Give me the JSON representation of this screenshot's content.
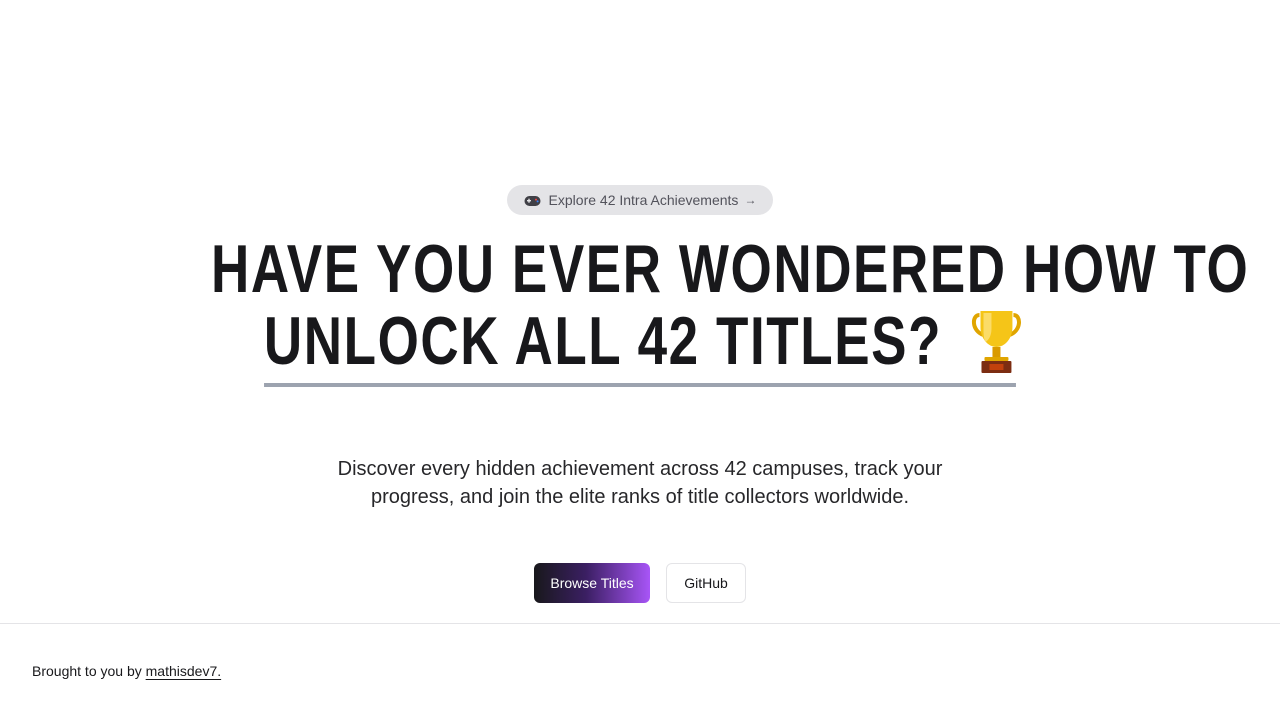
{
  "hero": {
    "pill_label": "Explore 42 Intra Achievements",
    "pill_arrow": "→",
    "headline_line1": "HAVE YOU EVER WONDERED HOW TO",
    "headline_line2": "UNLOCK ALL 42 TITLES?",
    "subtitle": "Discover every hidden achievement across 42 campuses, track your progress, and join the elite ranks of title collectors worldwide."
  },
  "buttons": {
    "primary_label": "Browse Titles",
    "secondary_label": "GitHub"
  },
  "footer": {
    "prefix": "Brought to you by",
    "author_link": "mathisdev7."
  },
  "icons": {
    "pill_icon": "gamepad-icon",
    "headline_icon": "trophy-icon"
  },
  "colors": {
    "background": "#ffffff",
    "text": "#18181b",
    "pill_bg": "#e4e4e7",
    "underline": "#9ca3af",
    "gradient_start": "#18181b",
    "gradient_end": "#a855f7"
  }
}
